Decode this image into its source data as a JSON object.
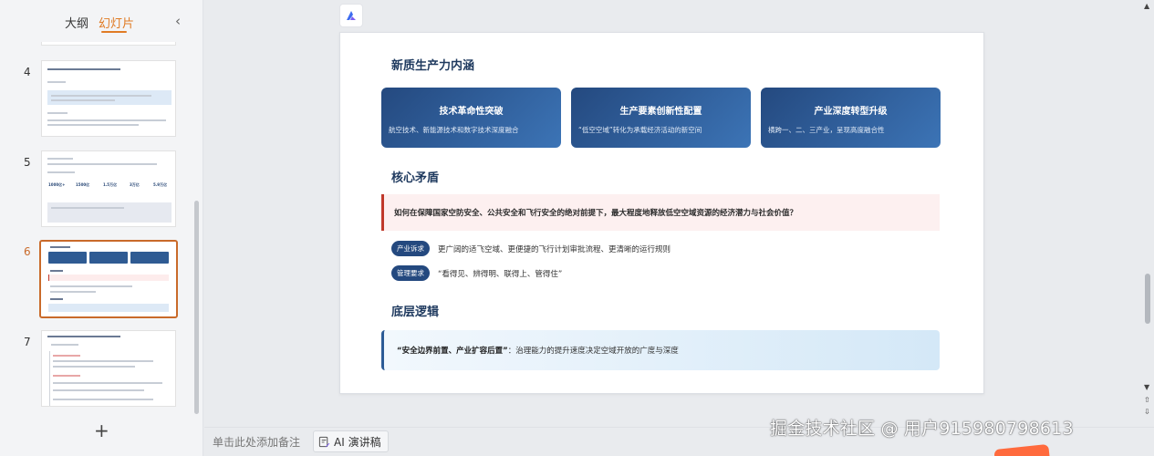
{
  "sidebar": {
    "tabs": [
      {
        "label": "大纲"
      },
      {
        "label": "幻灯片"
      }
    ],
    "collapse_icon": "chevron-left-icon",
    "thumbnails": [
      {
        "number": "4"
      },
      {
        "number": "5",
        "stats": [
          "1000亿+",
          "1500亿",
          "1.5万亿",
          "3万亿",
          "5.9万亿"
        ]
      },
      {
        "number": "6"
      },
      {
        "number": "7"
      }
    ],
    "add_slide_label": "+"
  },
  "slide": {
    "section1_title": "新质生产力内涵",
    "cards": [
      {
        "title": "技术革命性突破",
        "desc": "航空技术、新能源技术和数字技术深度融合"
      },
      {
        "title": "生产要素创新性配置",
        "desc": "“低空空域”转化为承载经济活动的新空间"
      },
      {
        "title": "产业深度转型升级",
        "desc": "横跨一、二、三产业，呈现高度融合性"
      }
    ],
    "section2_title": "核心矛盾",
    "conflict_question": "如何在保障国家空防安全、公共安全和飞行安全的绝对前提下，最大程度地释放低空空域资源的经济潜力与社会价值？",
    "demands": [
      {
        "tag": "产业诉求",
        "text": "更广阔的适飞空域、更便捷的飞行计划审批流程、更清晰的运行规则"
      },
      {
        "tag": "管理要求",
        "text": "“看得见、辨得明、联得上、管得住”"
      }
    ],
    "section3_title": "底层逻辑",
    "logic_strong": "“安全边界前置、产业扩容后置”",
    "logic_rest": "：治理能力的提升速度决定空域开放的广度与深度"
  },
  "bottom_bar": {
    "notes_placeholder": "单击此处添加备注",
    "ai_script_label": "AI 演讲稿"
  },
  "watermark": "掘金技术社区 @ 用户915980798613",
  "colors": {
    "accent": "#e07b24",
    "card_dark": "#24497f",
    "card_light": "#3c74b6",
    "conflict_red": "#c0392b"
  }
}
